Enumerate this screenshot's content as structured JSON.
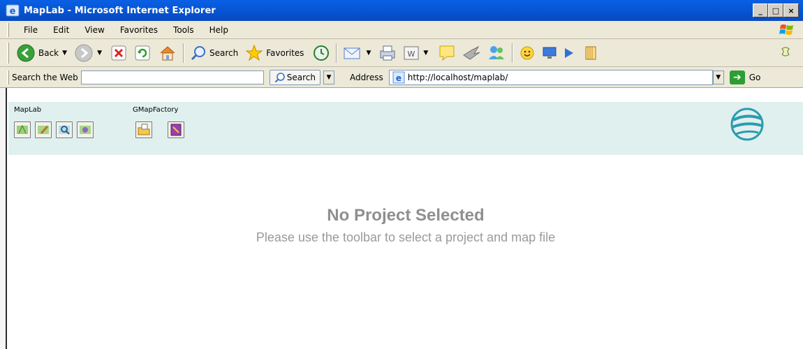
{
  "window": {
    "title": "MapLab - Microsoft Internet Explorer",
    "minimize": "_",
    "maximize": "□",
    "close": "×"
  },
  "menu": {
    "items": [
      "File",
      "Edit",
      "View",
      "Favorites",
      "Tools",
      "Help"
    ]
  },
  "toolbar": {
    "back_label": "Back",
    "search_label": "Search",
    "favorites_label": "Favorites",
    "icons": [
      "back-icon",
      "forward-icon",
      "stop-icon",
      "refresh-icon",
      "home-icon",
      "search-icon",
      "favorites-icon",
      "history-icon",
      "mail-icon",
      "print-icon",
      "edit-icon",
      "discuss-icon",
      "research-icon",
      "messenger-icon",
      "smiley-icon",
      "monitor-icon",
      "play-icon",
      "notepad-icon",
      "extension-icon"
    ]
  },
  "addressbar": {
    "search_web_label": "Search the Web",
    "search_value": "",
    "search_button": "Search",
    "address_label": "Address",
    "url": "http://localhost/maplab/",
    "go_label": "Go"
  },
  "page": {
    "maplab_label": "MapLab",
    "gmapfactory_label": "GMapFactory",
    "tool_icons": [
      "map-edit-icon",
      "map-browse-icon",
      "map-query-icon",
      "map-settings-icon",
      "gmap-open-icon",
      "gmap-book-icon"
    ],
    "message_title": "No Project Selected",
    "message_subtitle": "Please use the toolbar to select a project and map file"
  },
  "colors": {
    "titlebar": "#0658d8",
    "chrome": "#ece9d8",
    "header_bg": "#e0f0ef",
    "message_text": "#8f8f8f"
  }
}
